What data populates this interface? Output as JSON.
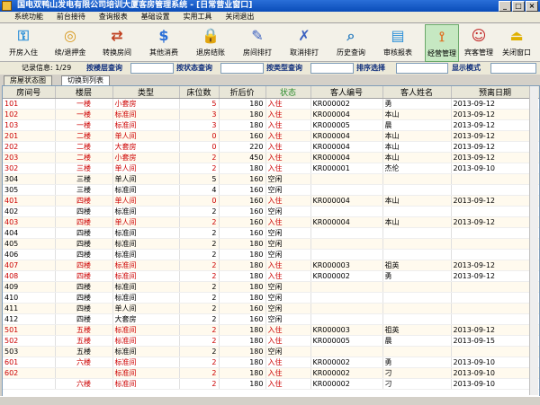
{
  "window": {
    "title": "国电双鸭山发电有限公司培训大厦客房管理系统 - [日常营业窗口]",
    "buttons": [
      "_",
      "□",
      "×"
    ]
  },
  "menu": [
    "系统功能",
    "前台接待",
    "查询报表",
    "基础设置",
    "实用工具",
    "关闭退出"
  ],
  "toolbar": [
    {
      "label": "开房入住",
      "icon": "key-icon",
      "color": "#2a8fd8"
    },
    {
      "label": "续/退押金",
      "icon": "coins-icon",
      "color": "#d89a20"
    },
    {
      "label": "转换房间",
      "icon": "transfer-icon",
      "color": "#c04020"
    },
    {
      "label": "其他消费",
      "icon": "dollar-icon",
      "color": "#2a6fd8"
    },
    {
      "label": "退房结账",
      "icon": "lock-icon",
      "color": "#e0a020"
    },
    {
      "label": "房间排打",
      "icon": "broom-icon",
      "color": "#3a60c0"
    },
    {
      "label": "取消排打",
      "icon": "broom-cancel-icon",
      "color": "#3a60c0"
    },
    {
      "label": "历史查询",
      "icon": "history-search-icon",
      "color": "#3080c0"
    },
    {
      "label": "审核报表",
      "icon": "report-icon",
      "color": "#2a8fd8"
    },
    {
      "label": "经营管理",
      "icon": "rss-icon",
      "color": "#e07020"
    },
    {
      "label": "宾客管理",
      "icon": "guest-icon",
      "color": "#c02020"
    },
    {
      "label": "关闭窗口",
      "icon": "exit-icon",
      "color": "#e0b000"
    }
  ],
  "filter": {
    "record_info": "记录信息: 1/29",
    "by_floor": "按楼层查询",
    "by_status": "按状态查询",
    "by_type": "按类型查询",
    "sort": "排序选择",
    "display_mode": "显示模式"
  },
  "tabs": [
    "房屋状态图",
    "切换到列表"
  ],
  "table": {
    "columns": [
      "房间号",
      "楼层",
      "类型",
      "床位数",
      "折后价",
      "状态",
      "客人编号",
      "客人姓名",
      "预离日期"
    ],
    "rows": [
      [
        "101",
        "一楼",
        "小套房",
        "5",
        "180",
        "入住",
        "KR000002",
        "勇",
        "2013-09-12"
      ],
      [
        "102",
        "一楼",
        "标准间",
        "3",
        "180",
        "入住",
        "KR000004",
        "本山",
        "2013-09-12"
      ],
      [
        "103",
        "一楼",
        "标准间",
        "3",
        "180",
        "入住",
        "KR000005",
        "晨",
        "2013-09-12"
      ],
      [
        "201",
        "二楼",
        "单人间",
        "0",
        "160",
        "入住",
        "KR000004",
        "本山",
        "2013-09-12"
      ],
      [
        "202",
        "二楼",
        "大套房",
        "0",
        "220",
        "入住",
        "KR000004",
        "本山",
        "2013-09-12"
      ],
      [
        "203",
        "二楼",
        "小套房",
        "2",
        "450",
        "入住",
        "KR000004",
        "本山",
        "2013-09-12"
      ],
      [
        "302",
        "三楼",
        "单人间",
        "2",
        "180",
        "入住",
        "KR000001",
        "杰伦",
        "2013-09-10"
      ],
      [
        "304",
        "三楼",
        "单人间",
        "5",
        "160",
        "空闲",
        "",
        "",
        ""
      ],
      [
        "305",
        "三楼",
        "标准间",
        "4",
        "160",
        "空闲",
        "",
        "",
        ""
      ],
      [
        "401",
        "四楼",
        "单人间",
        "0",
        "160",
        "入住",
        "KR000004",
        "本山",
        "2013-09-12"
      ],
      [
        "402",
        "四楼",
        "标准间",
        "2",
        "160",
        "空闲",
        "",
        "",
        ""
      ],
      [
        "403",
        "四楼",
        "单人间",
        "2",
        "160",
        "入住",
        "KR000004",
        "本山",
        "2013-09-12"
      ],
      [
        "404",
        "四楼",
        "标准间",
        "2",
        "160",
        "空闲",
        "",
        "",
        ""
      ],
      [
        "405",
        "四楼",
        "标准间",
        "2",
        "180",
        "空闲",
        "",
        "",
        ""
      ],
      [
        "406",
        "四楼",
        "标准间",
        "2",
        "180",
        "空闲",
        "",
        "",
        ""
      ],
      [
        "407",
        "四楼",
        "标准间",
        "2",
        "180",
        "入住",
        "KR000003",
        "祖英",
        "2013-09-12"
      ],
      [
        "408",
        "四楼",
        "标准间",
        "2",
        "180",
        "入住",
        "KR000002",
        "勇",
        "2013-09-12"
      ],
      [
        "409",
        "四楼",
        "标准间",
        "2",
        "180",
        "空闲",
        "",
        "",
        ""
      ],
      [
        "410",
        "四楼",
        "标准间",
        "2",
        "180",
        "空闲",
        "",
        "",
        ""
      ],
      [
        "411",
        "四楼",
        "单人间",
        "2",
        "160",
        "空闲",
        "",
        "",
        ""
      ],
      [
        "412",
        "四楼",
        "大套房",
        "2",
        "160",
        "空闲",
        "",
        "",
        ""
      ],
      [
        "501",
        "五楼",
        "标准间",
        "2",
        "180",
        "入住",
        "KR000003",
        "祖英",
        "2013-09-12"
      ],
      [
        "502",
        "五楼",
        "标准间",
        "2",
        "180",
        "入住",
        "KR000005",
        "晨",
        "2013-09-15"
      ],
      [
        "503",
        "五楼",
        "标准间",
        "2",
        "180",
        "空闲",
        "",
        "",
        ""
      ],
      [
        "601",
        "六楼",
        "标准间",
        "2",
        "180",
        "入住",
        "KR000002",
        "勇",
        "2013-09-10"
      ],
      [
        "602",
        "",
        "标准间",
        "2",
        "180",
        "入住",
        "KR000002",
        "刁",
        "2013-09-10"
      ],
      [
        "",
        "六楼",
        "标准间",
        "2",
        "180",
        "入住",
        "KR000002",
        "刁",
        "2013-09-10"
      ]
    ]
  },
  "colors": {
    "occupied_text": "#cc0000",
    "vacant_text": "#000000",
    "header_bg": "#e8e6d8"
  }
}
